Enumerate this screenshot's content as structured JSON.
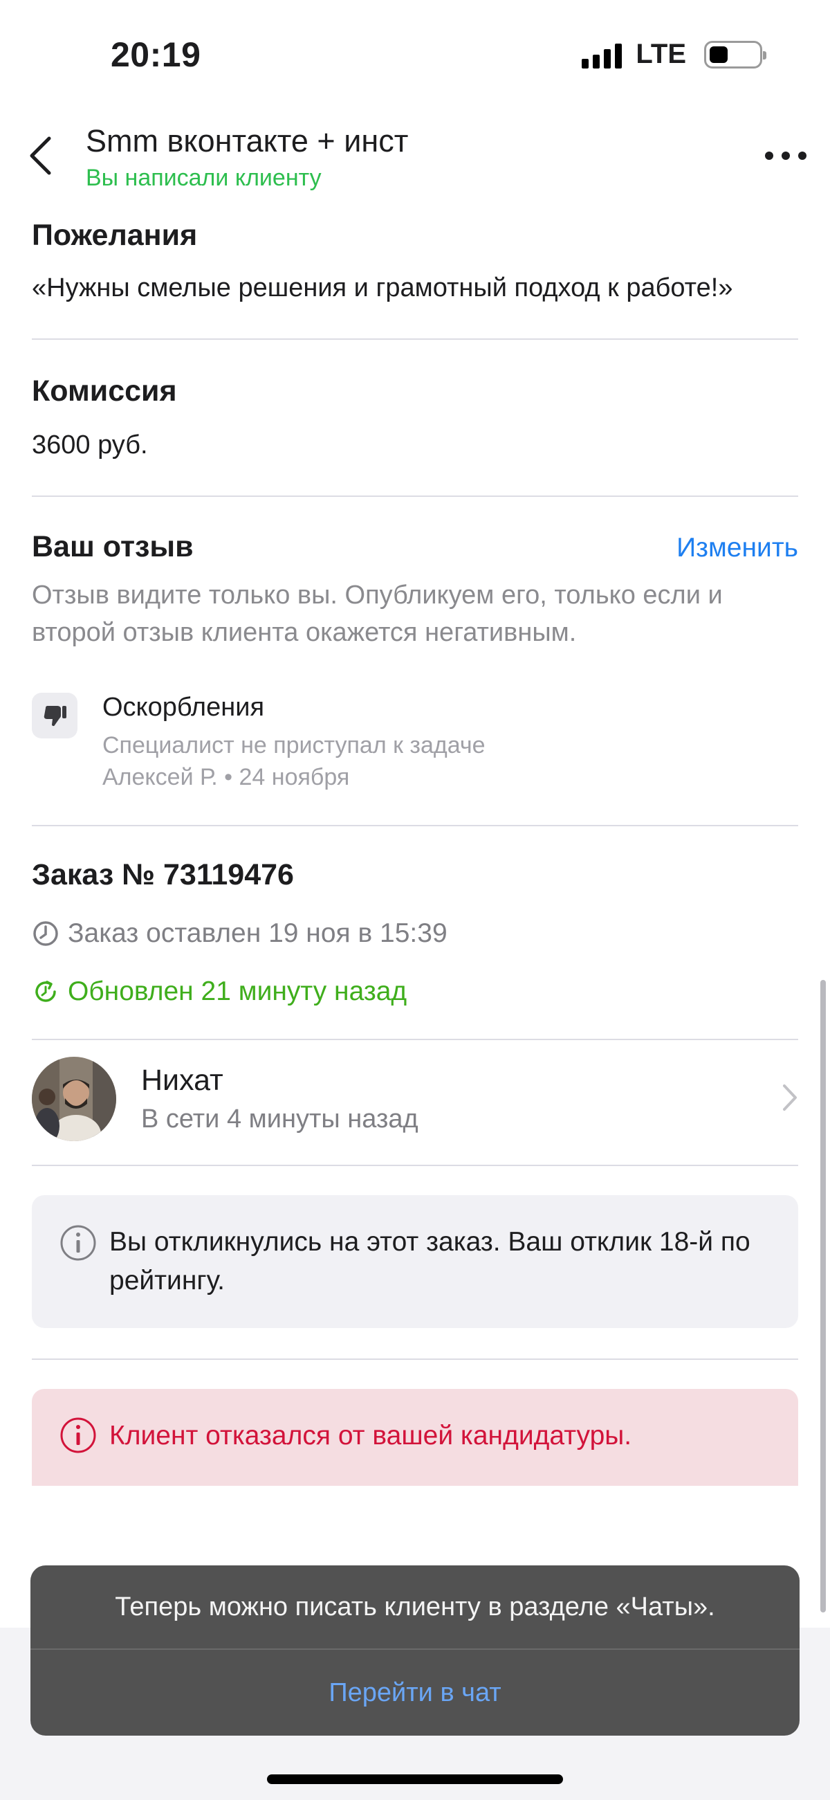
{
  "status_bar": {
    "time": "20:19",
    "network": "LTE"
  },
  "nav": {
    "title": "Smm вконтакте + инст",
    "subtitle": "Вы написали клиенту"
  },
  "wishes": {
    "heading": "Пожелания",
    "text": "«Нужны смелые решения и грамотный подход к работе!»"
  },
  "commission": {
    "heading": "Комиссия",
    "value": "3600 руб."
  },
  "your_review": {
    "heading": "Ваш отзыв",
    "edit_label": "Изменить",
    "note": "Отзыв видите только вы. Опубликуем его, только если и второй отзыв клиента окажется негативным.",
    "item": {
      "title": "Оскорбления",
      "subtitle": "Специалист не приступал к задаче",
      "author_date": "Алексей Р. • 24 ноября"
    }
  },
  "order": {
    "heading": "Заказ № 73119476",
    "created": "Заказ оставлен 19 ноя в 15:39",
    "updated": "Обновлен 21 минуту назад"
  },
  "client": {
    "name": "Нихат",
    "status": "В сети 4 минуты назад"
  },
  "info_notice": "Вы откликнулись на этот заказ. Ваш отклик 18-й по рейтингу.",
  "alert_notice": "Клиент отказался от вашей кандидатуры.",
  "toast": {
    "message": "Теперь можно писать клиенту в разделе «Чаты».",
    "action": "Перейти в чат"
  },
  "colors": {
    "accent_blue": "#1e7ff0",
    "success_green": "#3fae1c",
    "status_green": "#2dbe4e",
    "alert_red": "#d2133a",
    "alert_bg": "#f5dde1"
  },
  "icons": [
    "chevron-left-icon",
    "more-icon",
    "thumbs-down-icon",
    "clock-icon",
    "refresh-icon",
    "chevron-right-icon",
    "info-icon",
    "alert-icon"
  ]
}
